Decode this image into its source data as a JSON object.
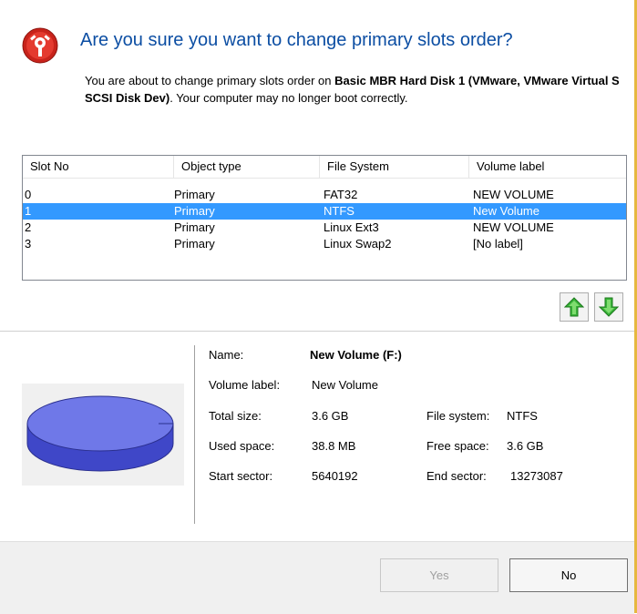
{
  "dialog": {
    "title": "Are you sure you want to change primary slots order?",
    "desc_prefix": "You are about to change primary slots order on ",
    "desc_bold": "Basic MBR Hard Disk 1 (VMware, VMware Virtual S SCSI Disk Dev)",
    "desc_suffix": ". Your computer may no longer boot correctly."
  },
  "table": {
    "headers": [
      "Slot No",
      "Object type",
      "File System",
      "Volume label"
    ],
    "rows": [
      {
        "slot": "0",
        "type": "Primary",
        "fs": "FAT32",
        "label": "NEW VOLUME"
      },
      {
        "slot": "1",
        "type": "Primary",
        "fs": "NTFS",
        "label": "New Volume"
      },
      {
        "slot": "2",
        "type": "Primary",
        "fs": "Linux Ext3",
        "label": "NEW VOLUME"
      },
      {
        "slot": "3",
        "type": "Primary",
        "fs": "Linux Swap2",
        "label": "[No label]"
      }
    ],
    "selected_index": 1
  },
  "details": {
    "name_label": "Name:",
    "name_value": "New Volume (F:)",
    "volume_label_label": "Volume label:",
    "volume_label_value": "New Volume",
    "total_size_label": "Total size:",
    "total_size_value": "3.6 GB",
    "file_system_label": "File system:",
    "file_system_value": "NTFS",
    "used_space_label": "Used space:",
    "used_space_value": "38.8 MB",
    "free_space_label": "Free space:",
    "free_space_value": "3.6 GB",
    "start_sector_label": "Start sector:",
    "start_sector_value": "5640192",
    "end_sector_label": "End sector:",
    "end_sector_value": "13273087"
  },
  "buttons": {
    "yes": "Yes",
    "no": "No",
    "yes_enabled": false
  },
  "colors": {
    "title": "#0c4ea3",
    "selection": "#3399ff",
    "arrow": "#2fa82f",
    "disk": "#6f78e8",
    "warning_icon": "#c8231b"
  },
  "icons": {
    "header": "warning-settings-icon",
    "move_up": "green-arrow-up-icon",
    "move_down": "green-arrow-down-icon",
    "disk": "disk-volume-icon"
  }
}
